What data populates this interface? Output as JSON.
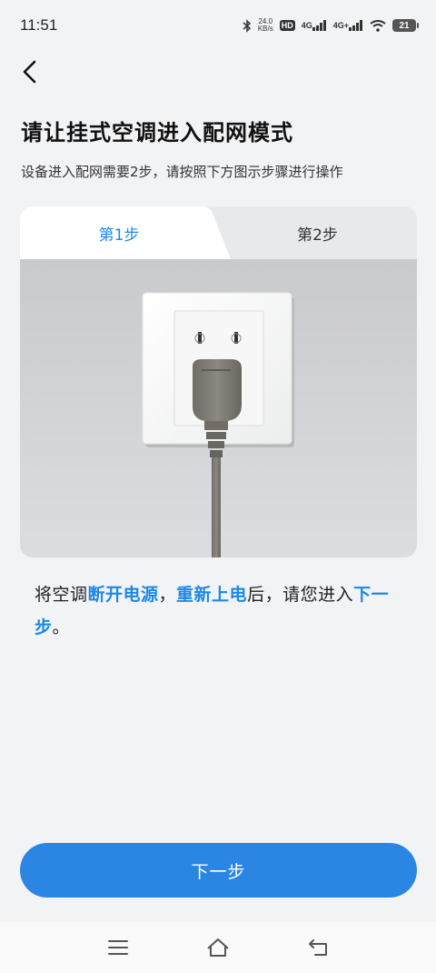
{
  "status": {
    "time": "11:51",
    "speed_value": "24.0",
    "speed_unit": "KB/s",
    "hd_label": "HD",
    "sim1_label": "4G",
    "sim2_label": "4G+",
    "battery": "21"
  },
  "header": {
    "title": "请让挂式空调进入配网模式",
    "subtitle": "设备进入配网需要2步，请按照下方图示步骤进行操作"
  },
  "tabs": [
    {
      "label": "第1步",
      "active": true
    },
    {
      "label": "第2步",
      "active": false
    }
  ],
  "instruction": {
    "part1": "将空调",
    "hl1": "断开电源",
    "part2": "，",
    "hl2": "重新上电",
    "part3": "后，请您进入",
    "hl3": "下一步",
    "part4": "。"
  },
  "next_button_label": "下一步",
  "colors": {
    "accent": "#2a86e2",
    "highlight": "#1e88e5",
    "background": "#f2f3f5"
  },
  "icons": [
    "back-arrow-icon",
    "bluetooth-icon",
    "signal-icon",
    "wifi-icon",
    "battery-icon",
    "menu-icon",
    "home-icon",
    "back-icon"
  ]
}
